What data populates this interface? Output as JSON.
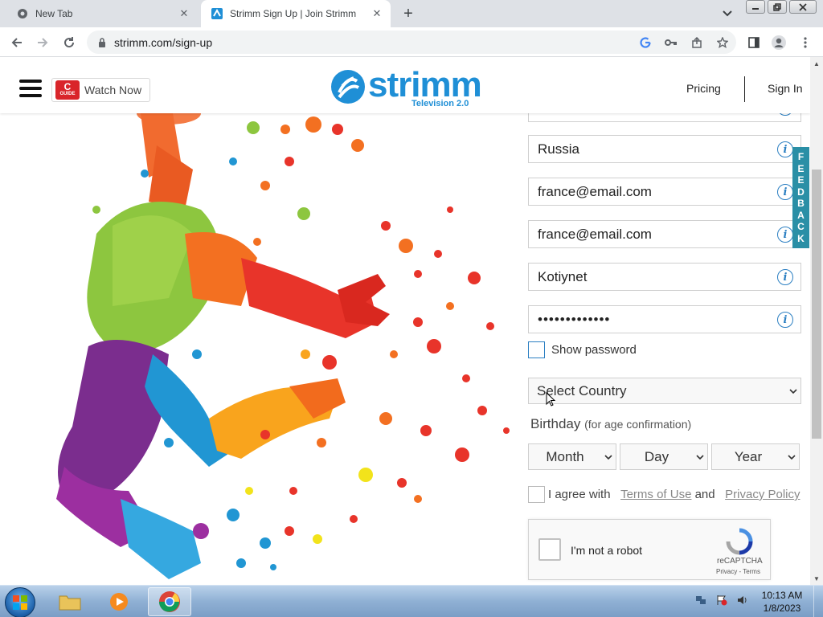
{
  "browser": {
    "tabs": [
      {
        "title": "New Tab",
        "close": "✕"
      },
      {
        "title": "Strimm Sign Up | Join Strimm",
        "close": "✕"
      }
    ],
    "new_tab": "+",
    "url": "strimm.com/sign-up"
  },
  "header": {
    "watch_now": "Watch Now",
    "guide_top": "C",
    "guide_bottom": "GUIDE",
    "brand_name": "strimm",
    "brand_tagline": "Television 2.0",
    "nav_pricing": "Pricing",
    "nav_signin": "Sign In"
  },
  "form": {
    "country": "Russia",
    "email": "france@email.com",
    "email_confirm": "france@email.com",
    "username": "Kotiynet",
    "password": "•••••••••••••",
    "show_password": "Show password",
    "select_country": "Select Country",
    "birthday_label": "Birthday",
    "birthday_note": "(for age confirmation)",
    "month": "Month",
    "day": "Day",
    "year": "Year",
    "agree_prefix": "I agree with",
    "terms": "Terms of Use",
    "and": "and",
    "privacy": "Privacy Policy",
    "info_glyph": "i"
  },
  "captcha": {
    "label": "I'm not a robot",
    "brand": "reCAPTCHA",
    "links": "Privacy - Terms"
  },
  "feedback": [
    "F",
    "E",
    "E",
    "D",
    "B",
    "A",
    "C",
    "K"
  ],
  "taskbar": {
    "time": "10:13 AM",
    "date": "1/8/2023"
  },
  "colors": {
    "brand_blue": "#1f8fd6",
    "feedback_teal": "#2a8fa6",
    "info_blue": "#2b7fc2"
  }
}
